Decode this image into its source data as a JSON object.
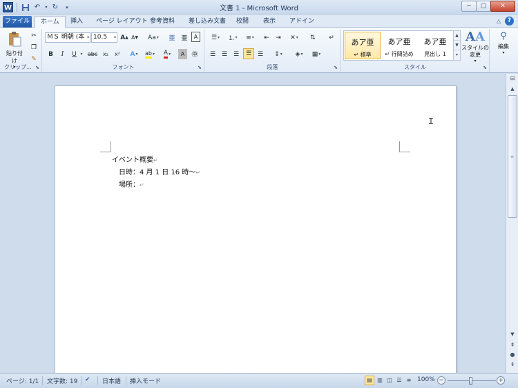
{
  "window": {
    "title": "文書 1 - Microsoft Word",
    "app_icon_letter": "W",
    "minimize_glyph": "─",
    "maximize_glyph": "▢",
    "close_glyph": "✕"
  },
  "ribbon_tabs": [
    {
      "label": "ファイル"
    },
    {
      "label": "ホーム"
    },
    {
      "label": "挿入"
    },
    {
      "label": "ページ レイアウト"
    },
    {
      "label": "参考資料"
    },
    {
      "label": "差し込み文書"
    },
    {
      "label": "校閲"
    },
    {
      "label": "表示"
    },
    {
      "label": "アドイン"
    }
  ],
  "clipboard": {
    "paste_label": "貼り付け",
    "group_label": "クリップ..."
  },
  "font": {
    "font_name": "ＭＳ 明朝 (本",
    "font_size": "10.5",
    "group_label": "フォント",
    "bold": "B",
    "italic": "I",
    "underline": "U",
    "strike": "abc",
    "subscript": "x₂",
    "superscript": "x²",
    "grow": "A",
    "shrink": "A",
    "case": "Aa",
    "clear_format": "A"
  },
  "paragraph": {
    "group_label": "段落"
  },
  "styles": {
    "group_label": "スタイル",
    "items": [
      {
        "preview": "あア亜",
        "name": "↵ 標準"
      },
      {
        "preview": "あア亜",
        "name": "↵ 行間詰め"
      },
      {
        "preview": "あア亜",
        "name": "見出し 1"
      }
    ],
    "change_styles_label": "スタイルの変更"
  },
  "editing": {
    "label": "編集"
  },
  "document": {
    "lines": [
      {
        "text": "イベント概要",
        "mark": "↵"
      },
      {
        "text": "日時：4 月 1 日 16 時～",
        "mark": "↵"
      },
      {
        "text": "場所：",
        "mark": "↵"
      }
    ]
  },
  "status": {
    "page": "ページ: 1/1",
    "word_count": "文字数: 19",
    "language": "日本語",
    "mode": "挿入モード",
    "zoom": "100%"
  },
  "colors": {
    "file_tab": "#1e56a5",
    "highlight_active": "#ffe69a",
    "ribbon_bg": "#e3ecf7",
    "doc_bg": "#cfdcec"
  }
}
